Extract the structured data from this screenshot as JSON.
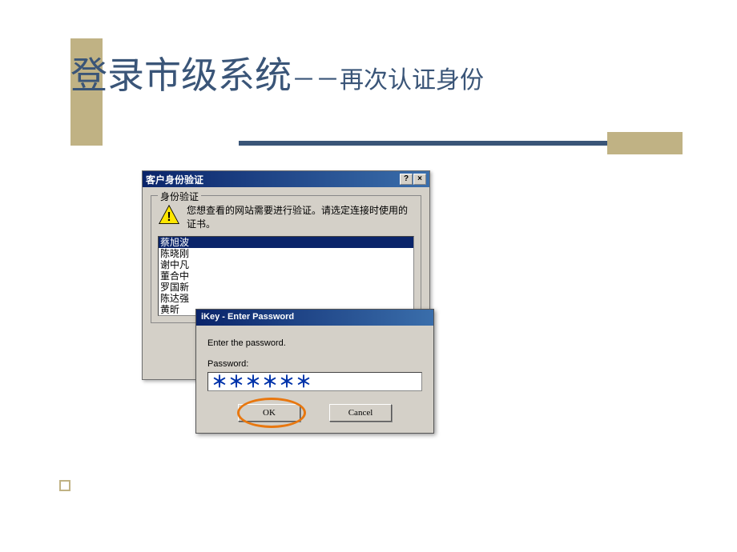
{
  "slide": {
    "title_main": "登录市级系统",
    "title_sub": "－－再次认证身份"
  },
  "dialog1": {
    "title": "客户身份验证",
    "help_btn": "?",
    "close_btn": "×",
    "group_label": "身份验证",
    "warning_text": "您想查看的网站需要进行验证。请选定连接时使用的证书。",
    "certs": [
      "蔡旭波",
      "陈晓刚",
      "谢中凡",
      "董合中",
      "罗国新",
      "陈达强",
      "黄昕"
    ]
  },
  "dialog2": {
    "title": "iKey - Enter Password",
    "instruction": "Enter the password.",
    "password_label": "Password:",
    "password_value": "＊＊＊＊＊＊",
    "ok_label": "OK",
    "cancel_label": "Cancel"
  }
}
